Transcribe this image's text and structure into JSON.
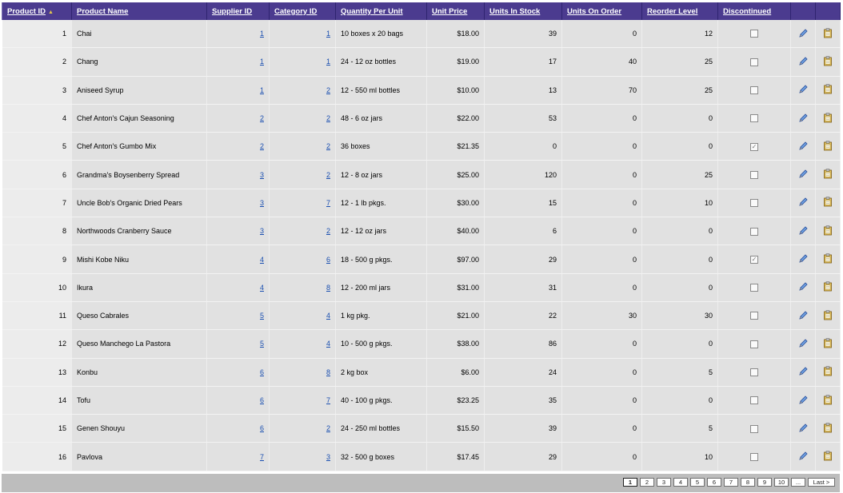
{
  "columns": [
    {
      "label": "Product ID",
      "sorted": true
    },
    {
      "label": "Product Name"
    },
    {
      "label": "Supplier ID"
    },
    {
      "label": "Category ID"
    },
    {
      "label": "Quantity Per Unit"
    },
    {
      "label": "Unit Price"
    },
    {
      "label": "Units In Stock"
    },
    {
      "label": "Units On Order"
    },
    {
      "label": "Reorder Level"
    },
    {
      "label": "Discontinued"
    }
  ],
  "icons": {
    "sort": "sort-ascending-icon",
    "edit": "pencil-edit-icon",
    "delete": "clipboard-delete-icon"
  },
  "colors": {
    "header_bg": "#4b3b8f",
    "header_text": "#ffffff",
    "row_bg": "#e1e1e1",
    "link": "#1a4fb0"
  },
  "rows": [
    {
      "id": "1",
      "name": "Chai",
      "supplier": "1",
      "category": "1",
      "qty": "10 boxes x 20 bags",
      "price": "$18.00",
      "stock": "39",
      "order": "0",
      "reorder": "12",
      "discontinued": false
    },
    {
      "id": "2",
      "name": "Chang",
      "supplier": "1",
      "category": "1",
      "qty": "24 - 12 oz bottles",
      "price": "$19.00",
      "stock": "17",
      "order": "40",
      "reorder": "25",
      "discontinued": false
    },
    {
      "id": "3",
      "name": "Aniseed Syrup",
      "supplier": "1",
      "category": "2",
      "qty": "12 - 550 ml bottles",
      "price": "$10.00",
      "stock": "13",
      "order": "70",
      "reorder": "25",
      "discontinued": false
    },
    {
      "id": "4",
      "name": "Chef Anton's Cajun Seasoning",
      "supplier": "2",
      "category": "2",
      "qty": "48 - 6 oz jars",
      "price": "$22.00",
      "stock": "53",
      "order": "0",
      "reorder": "0",
      "discontinued": false
    },
    {
      "id": "5",
      "name": "Chef Anton's Gumbo Mix",
      "supplier": "2",
      "category": "2",
      "qty": "36 boxes",
      "price": "$21.35",
      "stock": "0",
      "order": "0",
      "reorder": "0",
      "discontinued": true
    },
    {
      "id": "6",
      "name": "Grandma's Boysenberry Spread",
      "supplier": "3",
      "category": "2",
      "qty": "12 - 8 oz jars",
      "price": "$25.00",
      "stock": "120",
      "order": "0",
      "reorder": "25",
      "discontinued": false
    },
    {
      "id": "7",
      "name": "Uncle Bob's Organic Dried Pears",
      "supplier": "3",
      "category": "7",
      "qty": "12 - 1 lb pkgs.",
      "price": "$30.00",
      "stock": "15",
      "order": "0",
      "reorder": "10",
      "discontinued": false
    },
    {
      "id": "8",
      "name": "Northwoods Cranberry Sauce",
      "supplier": "3",
      "category": "2",
      "qty": "12 - 12 oz jars",
      "price": "$40.00",
      "stock": "6",
      "order": "0",
      "reorder": "0",
      "discontinued": false
    },
    {
      "id": "9",
      "name": "Mishi Kobe Niku",
      "supplier": "4",
      "category": "6",
      "qty": "18 - 500 g pkgs.",
      "price": "$97.00",
      "stock": "29",
      "order": "0",
      "reorder": "0",
      "discontinued": true
    },
    {
      "id": "10",
      "name": "Ikura",
      "supplier": "4",
      "category": "8",
      "qty": "12 - 200 ml jars",
      "price": "$31.00",
      "stock": "31",
      "order": "0",
      "reorder": "0",
      "discontinued": false
    },
    {
      "id": "11",
      "name": "Queso Cabrales",
      "supplier": "5",
      "category": "4",
      "qty": "1 kg pkg.",
      "price": "$21.00",
      "stock": "22",
      "order": "30",
      "reorder": "30",
      "discontinued": false
    },
    {
      "id": "12",
      "name": "Queso Manchego La Pastora",
      "supplier": "5",
      "category": "4",
      "qty": "10 - 500 g pkgs.",
      "price": "$38.00",
      "stock": "86",
      "order": "0",
      "reorder": "0",
      "discontinued": false
    },
    {
      "id": "13",
      "name": "Konbu",
      "supplier": "6",
      "category": "8",
      "qty": "2 kg box",
      "price": "$6.00",
      "stock": "24",
      "order": "0",
      "reorder": "5",
      "discontinued": false
    },
    {
      "id": "14",
      "name": "Tofu",
      "supplier": "6",
      "category": "7",
      "qty": "40 - 100 g pkgs.",
      "price": "$23.25",
      "stock": "35",
      "order": "0",
      "reorder": "0",
      "discontinued": false
    },
    {
      "id": "15",
      "name": "Genen Shouyu",
      "supplier": "6",
      "category": "2",
      "qty": "24 - 250 ml bottles",
      "price": "$15.50",
      "stock": "39",
      "order": "0",
      "reorder": "5",
      "discontinued": false
    },
    {
      "id": "16",
      "name": "Pavlova",
      "supplier": "7",
      "category": "3",
      "qty": "32 - 500 g boxes",
      "price": "$17.45",
      "stock": "29",
      "order": "0",
      "reorder": "10",
      "discontinued": false
    }
  ],
  "pager": {
    "pages": [
      "1",
      "2",
      "3",
      "4",
      "5",
      "6",
      "7",
      "8",
      "9",
      "10",
      "..."
    ],
    "current": "1",
    "last_label": "Last >"
  }
}
